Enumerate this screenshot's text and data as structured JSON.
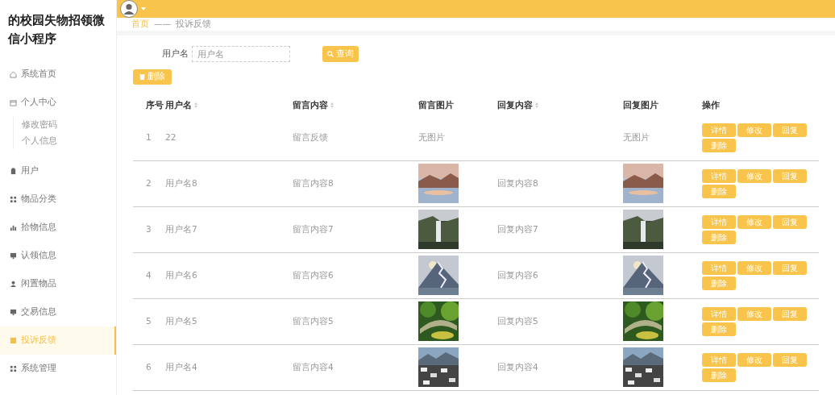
{
  "app_title": "的校园失物招领微信小程序",
  "sidebar": {
    "items": [
      {
        "label": "系统首页",
        "selected": false
      },
      {
        "label": "个人中心",
        "selected": false,
        "children": [
          {
            "label": "修改密码",
            "selected": false
          },
          {
            "label": "个人信息",
            "selected": false
          }
        ]
      },
      {
        "label": "用户",
        "selected": false
      },
      {
        "label": "物品分类",
        "selected": false
      },
      {
        "label": "拾物信息",
        "selected": false
      },
      {
        "label": "认领信息",
        "selected": false
      },
      {
        "label": "闲置物品",
        "selected": false
      },
      {
        "label": "交易信息",
        "selected": false
      },
      {
        "label": "投诉反馈",
        "selected": true
      },
      {
        "label": "系统管理",
        "selected": false
      }
    ]
  },
  "breadcrumb": [
    "首页",
    "——",
    "投诉反馈"
  ],
  "search": {
    "label": "用户名",
    "placeholder": "用户名",
    "button": "查询"
  },
  "delete_button": "删除",
  "table": {
    "columns": [
      {
        "label": "序号",
        "sortable": false
      },
      {
        "label": "用户名",
        "sortable": true
      },
      {
        "label": "留言内容",
        "sortable": true
      },
      {
        "label": "留言图片",
        "sortable": false
      },
      {
        "label": "回复内容",
        "sortable": true
      },
      {
        "label": "回复图片",
        "sortable": false
      },
      {
        "label": "操作",
        "sortable": false
      }
    ],
    "rows": [
      {
        "no": "1",
        "username": "22",
        "message": "留言反馈",
        "message_image": "无图片",
        "reply_image": "无图片",
        "actions": [
          "详情",
          "修改",
          "回复",
          "删除"
        ]
      },
      {
        "no": "2",
        "username": "用户名8",
        "message": "留言内容8",
        "message_image": {
          "kind": "picture"
        },
        "reply": "回复内容8",
        "reply_image": {
          "kind": "picture"
        },
        "actions": [
          "详情",
          "修改",
          "回复",
          "删除"
        ]
      },
      {
        "no": "3",
        "username": "用户名7",
        "message": "留言内容7",
        "message_image": {
          "kind": "picture"
        },
        "reply": "回复内容7",
        "reply_image": {
          "kind": "picture"
        },
        "actions": [
          "详情",
          "修改",
          "回复",
          "删除"
        ]
      },
      {
        "no": "4",
        "username": "用户名6",
        "message": "留言内容6",
        "message_image": {
          "kind": "picture"
        },
        "reply": "回复内容6",
        "reply_image": {
          "kind": "picture"
        },
        "actions": [
          "详情",
          "修改",
          "回复",
          "删除"
        ]
      },
      {
        "no": "5",
        "username": "用户名5",
        "message": "留言内容5",
        "message_image": {
          "kind": "picture"
        },
        "reply": "回复内容5",
        "reply_image": {
          "kind": "picture"
        },
        "actions": [
          "详情",
          "修改",
          "回复",
          "删除"
        ]
      },
      {
        "no": "6",
        "username": "用户名4",
        "message": "留言内容4",
        "message_image": {
          "kind": "picture"
        },
        "reply": "回复内容4",
        "reply_image": {
          "kind": "picture"
        },
        "actions": [
          "详情",
          "修改",
          "回复",
          "删除"
        ]
      }
    ]
  }
}
